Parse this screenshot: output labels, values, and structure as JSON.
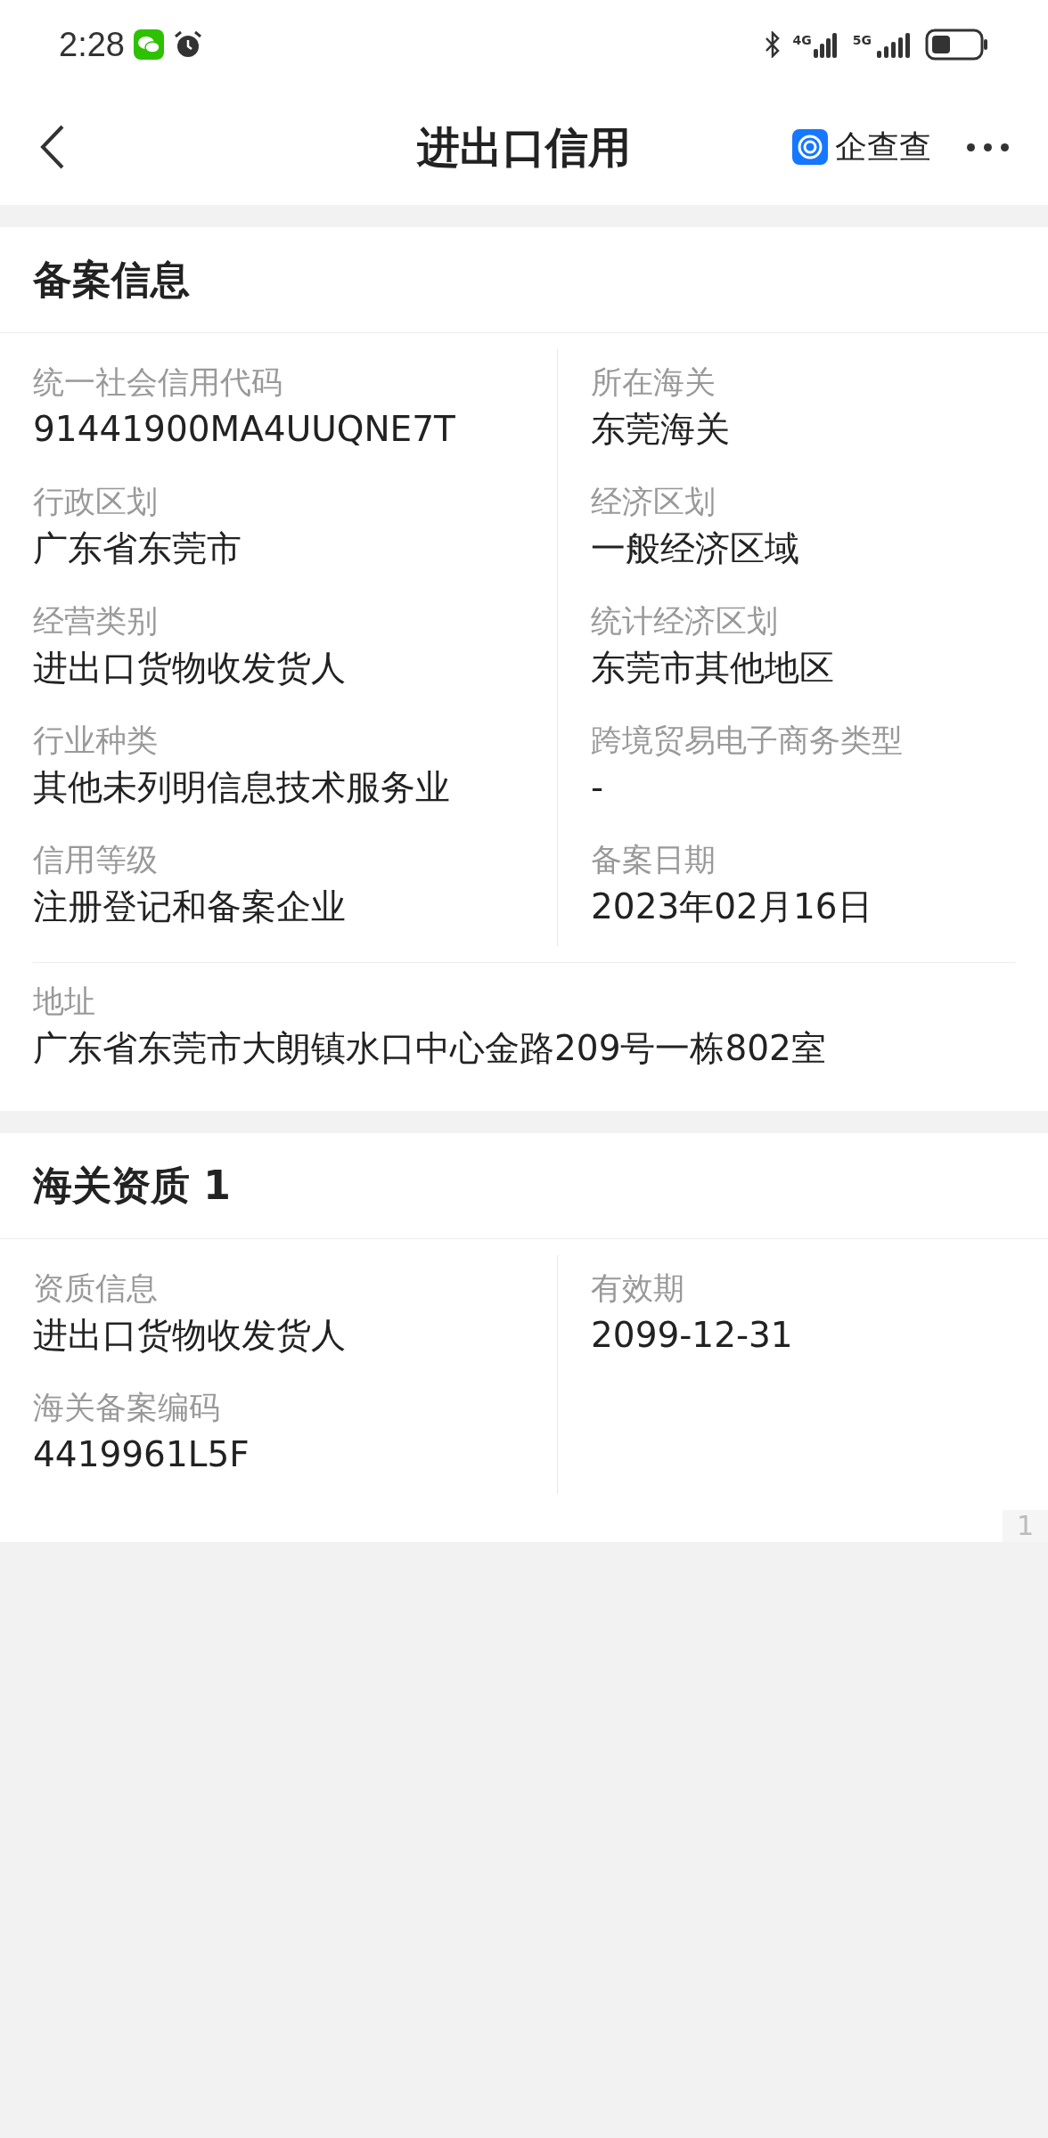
{
  "status_bar": {
    "time": "2:28",
    "network_1": "4G",
    "network_2": "5G"
  },
  "header": {
    "title": "进出口信用",
    "brand": "企查查"
  },
  "filing": {
    "title": "备案信息",
    "fields": [
      {
        "label": "统一社会信用代码",
        "value": "91441900MA4UUQNE7T"
      },
      {
        "label": "所在海关",
        "value": "东莞海关"
      },
      {
        "label": "行政区划",
        "value": "广东省东莞市"
      },
      {
        "label": "经济区划",
        "value": "一般经济区域"
      },
      {
        "label": "经营类别",
        "value": "进出口货物收发货人"
      },
      {
        "label": "统计经济区划",
        "value": "东莞市其他地区"
      },
      {
        "label": "行业种类",
        "value": "其他未列明信息技术服务业"
      },
      {
        "label": "跨境贸易电子商务类型",
        "value": "-"
      },
      {
        "label": "信用等级",
        "value": "注册登记和备案企业"
      },
      {
        "label": "备案日期",
        "value": "2023年02月16日"
      }
    ],
    "address": {
      "label": "地址",
      "value": "广东省东莞市大朗镇水口中心金路209号一栋802室"
    }
  },
  "qualification": {
    "title": "海关资质",
    "count": "1",
    "fields": [
      {
        "label": "资质信息",
        "value": "进出口货物收发货人"
      },
      {
        "label": "有效期",
        "value": "2099-12-31"
      },
      {
        "label": "海关备案编码",
        "value": "4419961L5F"
      }
    ]
  },
  "page_indicator": "1"
}
